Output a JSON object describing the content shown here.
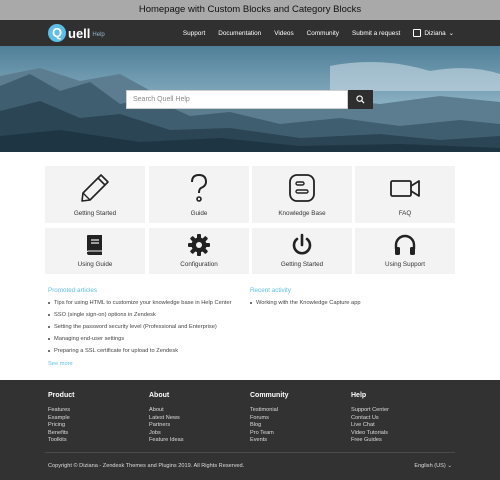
{
  "caption": "Homepage with Custom Blocks and Category Blocks",
  "brand": {
    "name": "uell",
    "logo_letter": "Q",
    "sub": "Help"
  },
  "nav": {
    "links": [
      "Support",
      "Documentation",
      "Videos",
      "Community",
      "Submit a request"
    ],
    "user": "Diziana"
  },
  "search": {
    "placeholder": "Search Quell Help"
  },
  "blocks": [
    {
      "label": "Getting Started",
      "icon": "pencil-icon"
    },
    {
      "label": "Guide",
      "icon": "question-mark-icon"
    },
    {
      "label": "Knowledge Base",
      "icon": "blogger-icon"
    },
    {
      "label": "FAQ",
      "icon": "video-camera-icon"
    }
  ],
  "categories": [
    {
      "label": "Using Guide",
      "icon": "book-icon"
    },
    {
      "label": "Configuration",
      "icon": "gear-icon"
    },
    {
      "label": "Getting Started",
      "icon": "power-icon"
    },
    {
      "label": "Using Support",
      "icon": "headphones-icon"
    }
  ],
  "promoted": {
    "title": "Promoted articles",
    "items": [
      "Tips for using HTML to customize your knowledge base in Help Center",
      "SSO (single sign-on) options in Zendesk",
      "Setting the password security level (Professional and Enterprise)",
      "Managing end-user settings",
      "Preparing a SSL certificate for upload to Zendesk"
    ],
    "see_more": "See more"
  },
  "recent": {
    "title": "Recent activity",
    "items": [
      "Working with the Knowledge Capture app"
    ]
  },
  "footer": {
    "columns": [
      {
        "title": "Product",
        "links": [
          "Features",
          "Example",
          "Pricing",
          "Benefits",
          "Toolkits"
        ]
      },
      {
        "title": "About",
        "links": [
          "About",
          "Latest News",
          "Partners",
          "Jobs",
          "Feature Ideas"
        ]
      },
      {
        "title": "Community",
        "links": [
          "Testimonial",
          "Forums",
          "Blog",
          "Pro Team",
          "Events"
        ]
      },
      {
        "title": "Help",
        "links": [
          "Support Center",
          "Contact Us",
          "Live Chat",
          "Video Tutorials",
          "Free Guides"
        ]
      }
    ],
    "copyright": "Copyright © Diziana - Zendesk Themes and Plugins 2019. All Rights Reserved.",
    "language": "English (US)"
  },
  "colors": {
    "accent": "#5dbfe8",
    "dark": "#303030"
  }
}
